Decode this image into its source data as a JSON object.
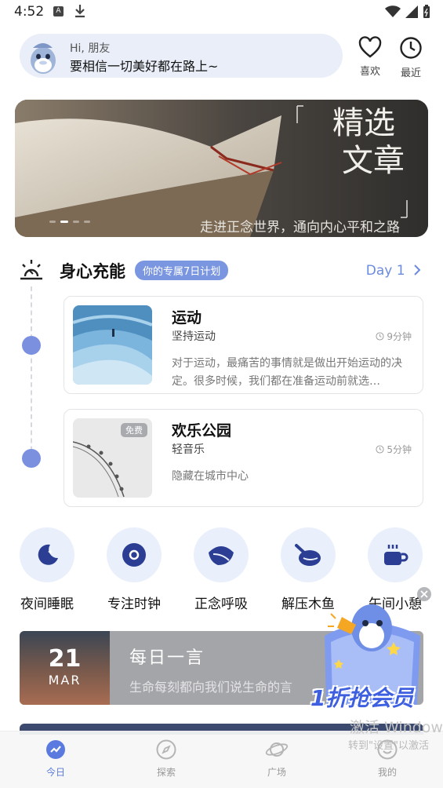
{
  "status": {
    "time": "4:52"
  },
  "greeting": {
    "hi": "Hi, 朋友",
    "message": "要相信一切美好都在路上~"
  },
  "top_actions": {
    "like": "喜欢",
    "recent": "最近"
  },
  "banner": {
    "title_line1": "精选",
    "title_line2": "文章",
    "subtitle": "走进正念世界，通向内心平和之路"
  },
  "section": {
    "title": "身心充能",
    "badge": "你的专属7日计划",
    "day": "Day 1"
  },
  "plans": [
    {
      "name": "运动",
      "sub": "坚持运动",
      "duration": "9分钟",
      "desc": "对于运动，最痛苦的事情就是做出开始运动的决定。很多时候，我们都在准备运动前就选…"
    },
    {
      "name": "欢乐公园",
      "sub": "轻音乐",
      "duration": "5分钟",
      "desc": "隐藏在城市中心",
      "badge": "免费"
    }
  ],
  "tools": [
    {
      "label": "夜间睡眠",
      "icon": "moon-icon"
    },
    {
      "label": "专注时钟",
      "icon": "focus-icon"
    },
    {
      "label": "正念呼吸",
      "icon": "leaf-icon"
    },
    {
      "label": "解压木鱼",
      "icon": "wooden-fish-icon"
    },
    {
      "label": "午间小憩",
      "icon": "coffee-icon"
    }
  ],
  "daily": {
    "day": "21",
    "month": "MAR",
    "title": "每日一言",
    "text": "生命每刻都向我们说生命的言"
  },
  "promo": {
    "text": "1折抢会员"
  },
  "watermark": {
    "line1": "激活 Windows",
    "line2": "转到\"设置\"以激活"
  },
  "nav": {
    "today": "今日",
    "explore": "探索",
    "square": "广场",
    "mine": "我的"
  },
  "colors": {
    "accent": "#6b8be0",
    "card_bg": "#e9eef8"
  }
}
